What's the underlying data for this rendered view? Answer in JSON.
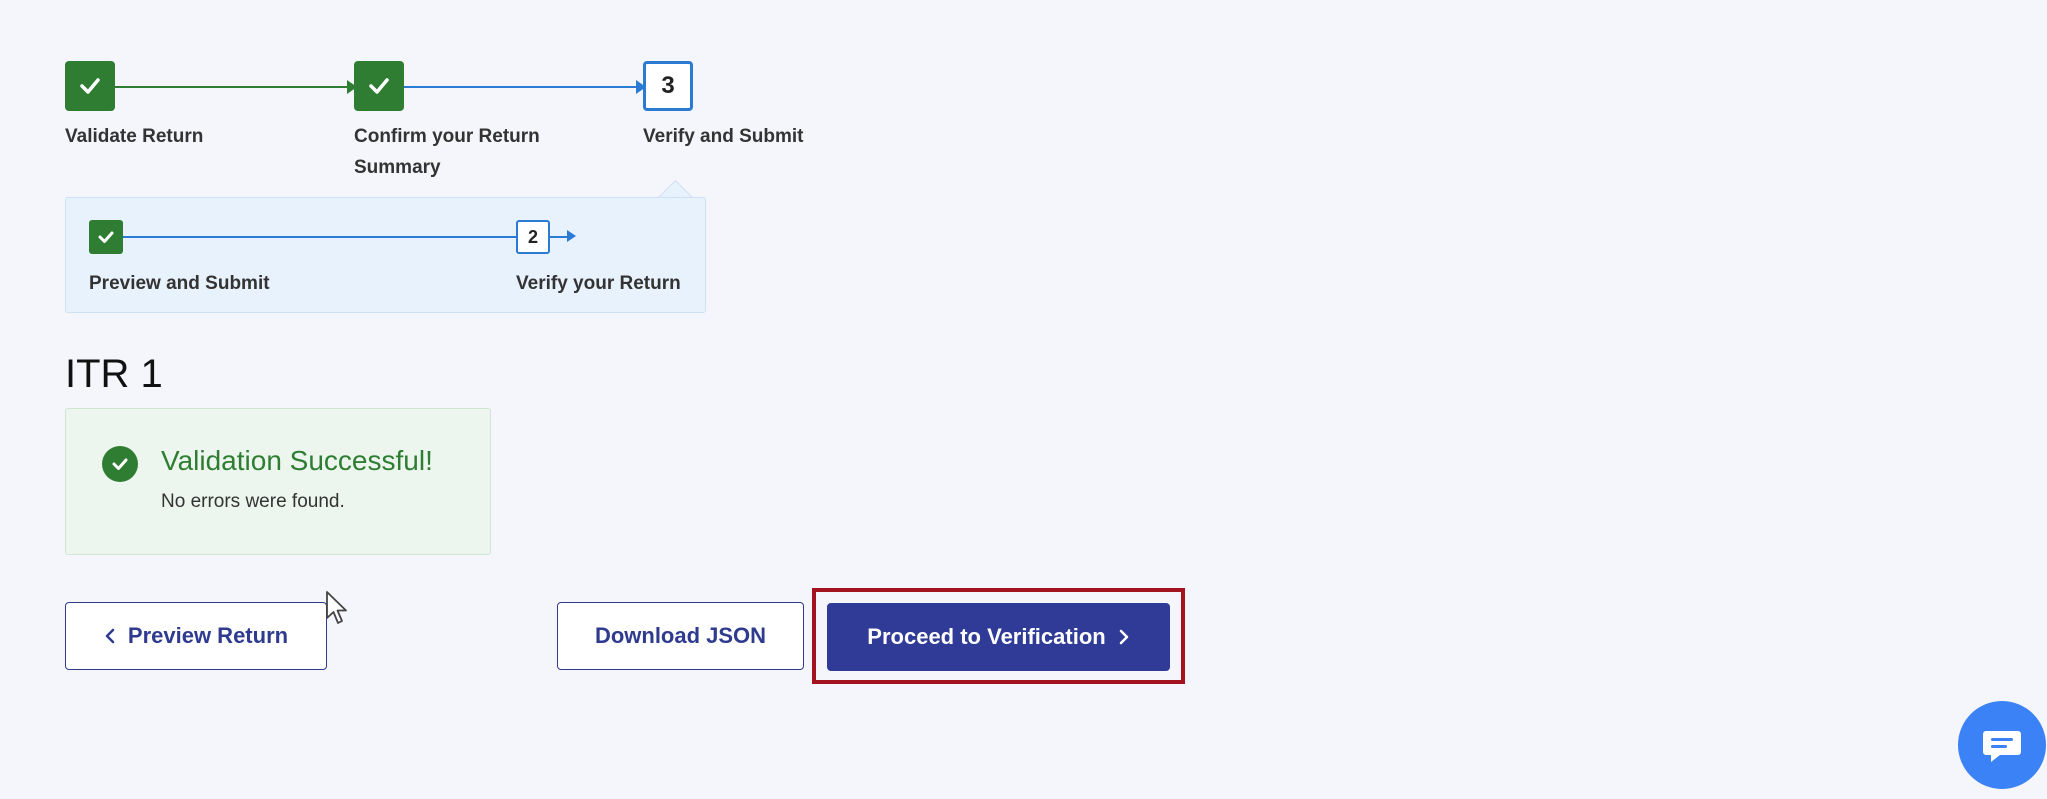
{
  "stepper": {
    "steps": [
      {
        "label": "Validate Return",
        "state": "done"
      },
      {
        "label_line1": "Confirm your Return",
        "label_line2": "Summary",
        "state": "done"
      },
      {
        "number": "3",
        "label": "Verify and Submit",
        "state": "current"
      }
    ]
  },
  "substepper": {
    "steps": [
      {
        "label": "Preview and Submit",
        "state": "done"
      },
      {
        "number": "2",
        "label": "Verify your Return",
        "state": "current"
      }
    ]
  },
  "page_title": "ITR 1",
  "alert": {
    "title": "Validation Successful!",
    "message": "No errors were found."
  },
  "buttons": {
    "preview": "Preview Return",
    "download": "Download JSON",
    "proceed": "Proceed to Verification"
  },
  "colors": {
    "done_green": "#2e7d32",
    "current_blue": "#2b7bd4",
    "primary": "#2f3b96",
    "highlight": "#a3141e"
  },
  "icons": {
    "check": "check-icon",
    "chat": "chat-icon"
  }
}
